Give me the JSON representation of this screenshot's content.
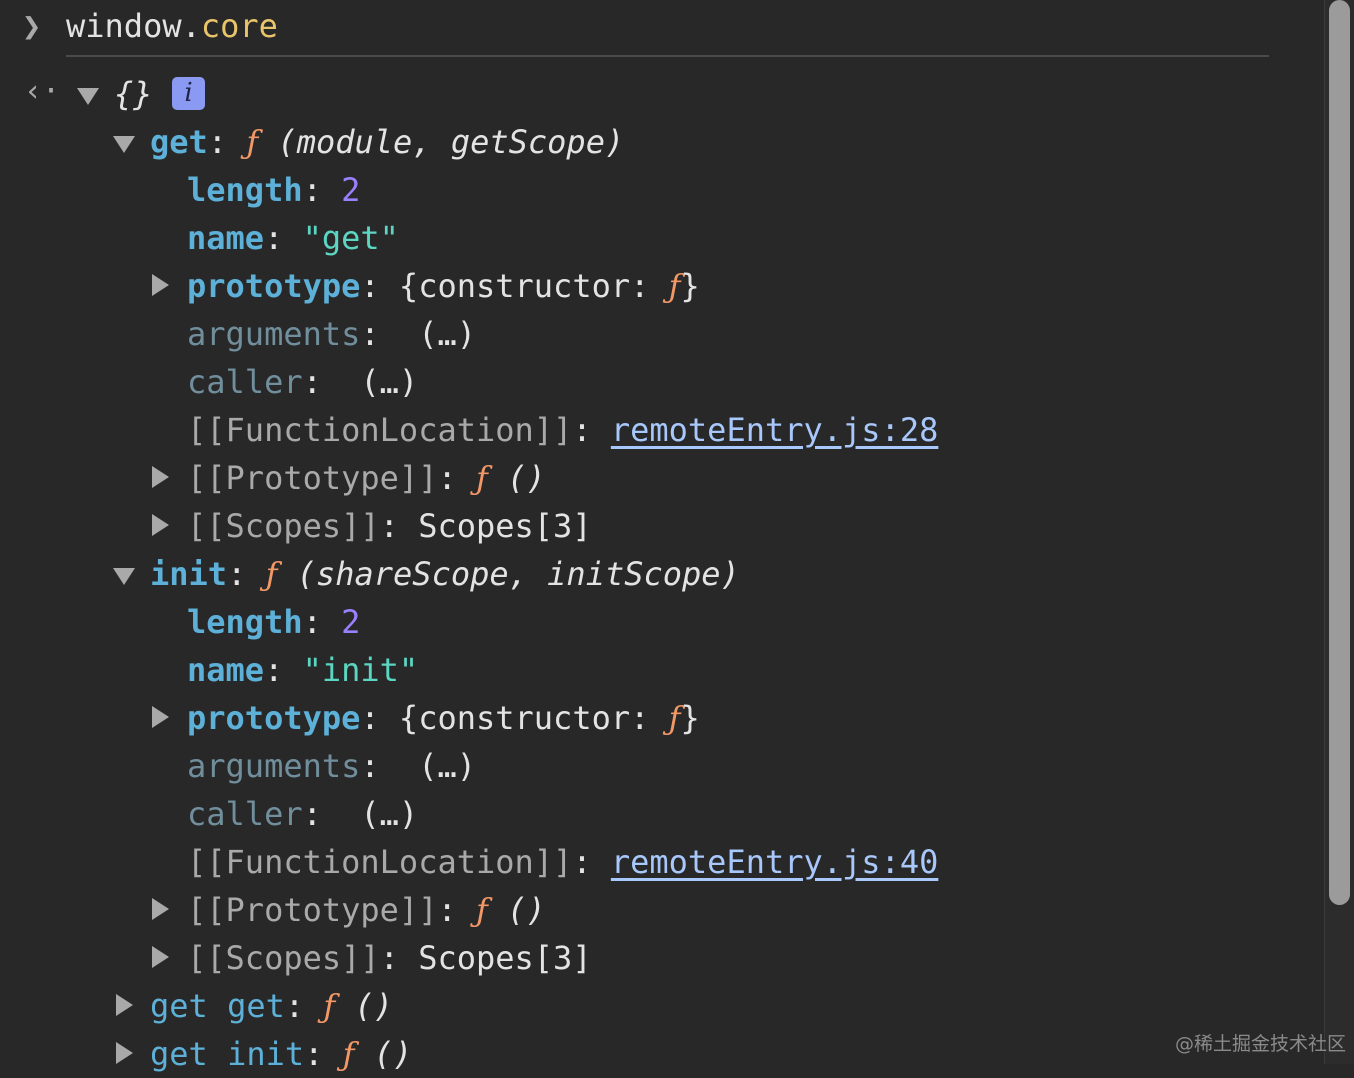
{
  "console": {
    "command": {
      "object": "window",
      "dot": ".",
      "prop": "core"
    },
    "root_label": "{}",
    "info_badge": "i",
    "get": {
      "key": "get",
      "f": "ƒ",
      "signature": "(module, getScope)",
      "length_key": "length",
      "length_val": "2",
      "name_key": "name",
      "name_val": "\"get\"",
      "prototype_key": "prototype",
      "prototype_val": "{constructor: ",
      "prototype_f": "ƒ",
      "prototype_close": "}",
      "arguments_key": "arguments",
      "arguments_val": "(…)",
      "caller_key": "caller",
      "caller_val": "(…)",
      "location_key": "[[FunctionLocation]]",
      "location_val": "remoteEntry.js:28",
      "proto_key": "[[Prototype]]",
      "proto_f": "ƒ",
      "proto_sig": "()",
      "scopes_key": "[[Scopes]]",
      "scopes_val": "Scopes[3]"
    },
    "init": {
      "key": "init",
      "f": "ƒ",
      "signature": "(shareScope, initScope)",
      "length_key": "length",
      "length_val": "2",
      "name_key": "name",
      "name_val": "\"init\"",
      "prototype_key": "prototype",
      "prototype_val": "{constructor: ",
      "prototype_f": "ƒ",
      "prototype_close": "}",
      "arguments_key": "arguments",
      "arguments_val": "(…)",
      "caller_key": "caller",
      "caller_val": "(…)",
      "location_key": "[[FunctionLocation]]",
      "location_val": "remoteEntry.js:40",
      "proto_key": "[[Prototype]]",
      "proto_f": "ƒ",
      "proto_sig": "()",
      "scopes_key": "[[Scopes]]",
      "scopes_val": "Scopes[3]"
    },
    "getter_get": {
      "key": "get get",
      "f": "ƒ",
      "sig": "()"
    },
    "getter_init": {
      "key": "get init",
      "f": "ƒ",
      "sig": "()"
    },
    "colon": ":"
  },
  "watermark": "@稀土掘金技术社区",
  "colors": {
    "background": "#282828",
    "key": "#5db0d7",
    "function": "#f29766",
    "number": "#9980ff",
    "string": "#5cd5c2",
    "link": "#a8c7fa"
  }
}
